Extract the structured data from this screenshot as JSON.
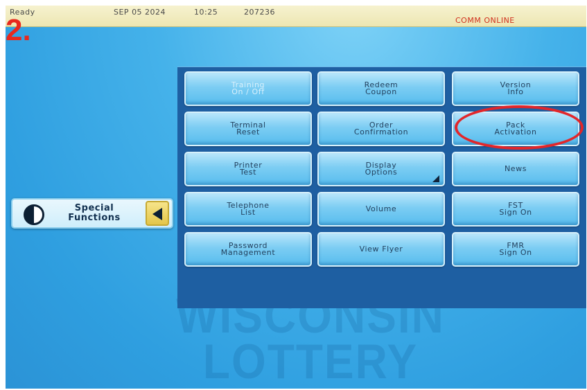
{
  "status_bar": {
    "state": "Ready",
    "date": "SEP 05 2024",
    "time": "10:25",
    "terminal_id": "207236",
    "comm_status": "COMM ONLINE"
  },
  "step_label": "2.",
  "watermark": {
    "line1": "WISCONSIN",
    "line2": "LOTTERY"
  },
  "special_functions": {
    "label": "Special\nFunctions",
    "icon": "half-circle-icon",
    "back_icon": "back-arrow-icon"
  },
  "menu": {
    "buttons": [
      {
        "label": "Training\nOn / Off",
        "enabled": false
      },
      {
        "label": "Redeem\nCoupon",
        "enabled": true
      },
      {
        "label": "Version\nInfo",
        "enabled": true
      },
      {
        "label": "Terminal\nReset",
        "enabled": true
      },
      {
        "label": "Order\nConfirmation",
        "enabled": true
      },
      {
        "label": "Pack\nActivation",
        "enabled": true,
        "highlighted": true
      },
      {
        "label": "Printer\nTest",
        "enabled": true
      },
      {
        "label": "Display\nOptions",
        "enabled": true,
        "submenu": true
      },
      {
        "label": "News",
        "enabled": true
      },
      {
        "label": "Telephone\nList",
        "enabled": true
      },
      {
        "label": "Volume",
        "enabled": true
      },
      {
        "label": "FST\nSign On",
        "enabled": true
      },
      {
        "label": "Password\nManagement",
        "enabled": true
      },
      {
        "label": "View Flyer",
        "enabled": true
      },
      {
        "label": "FMR\nSign On",
        "enabled": true
      }
    ]
  },
  "colors": {
    "highlight_ring": "#e2262a",
    "comm_online": "#d0301e",
    "step_label": "#e8291e"
  }
}
